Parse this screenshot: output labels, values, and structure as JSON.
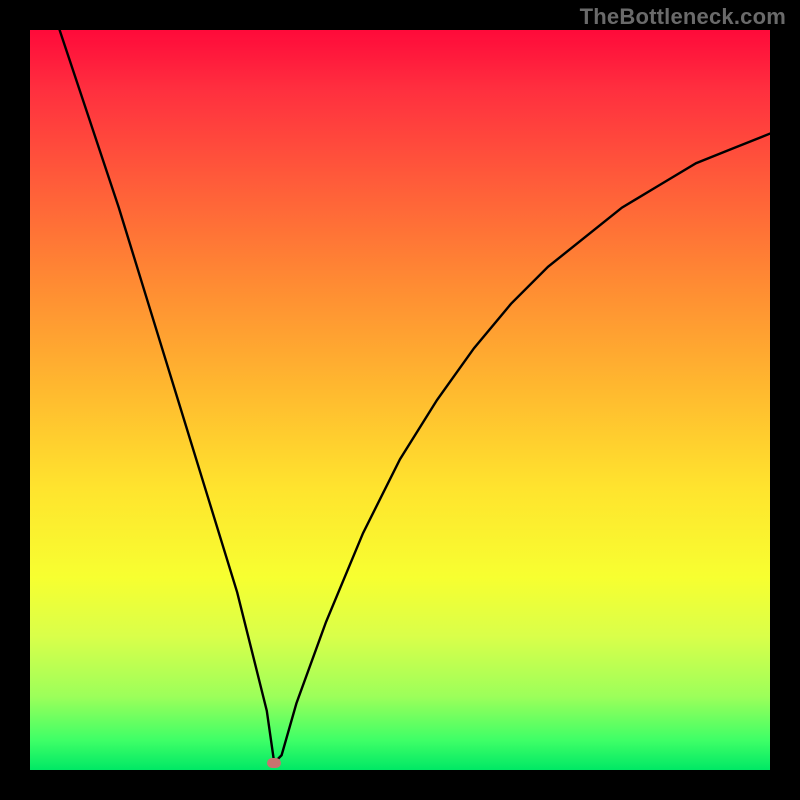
{
  "watermark": "TheBottleneck.com",
  "chart_data": {
    "type": "line",
    "title": "",
    "xlabel": "",
    "ylabel": "",
    "xlim": [
      0,
      100
    ],
    "ylim": [
      0,
      100
    ],
    "grid": false,
    "background_gradient": {
      "top": "#ff0a3a",
      "mid_upper": "#ff8a33",
      "mid_lower": "#ffe42e",
      "bottom": "#00e865"
    },
    "series": [
      {
        "name": "bottleneck-curve",
        "x": [
          4,
          8,
          12,
          16,
          20,
          24,
          28,
          32,
          33,
          34,
          36,
          40,
          45,
          50,
          55,
          60,
          65,
          70,
          75,
          80,
          85,
          90,
          95,
          100
        ],
        "y": [
          100,
          88,
          76,
          63,
          50,
          37,
          24,
          8,
          1,
          2,
          9,
          20,
          32,
          42,
          50,
          57,
          63,
          68,
          72,
          76,
          79,
          82,
          84,
          86
        ]
      }
    ],
    "marker": {
      "x": 33,
      "y": 1,
      "color": "#c7736f"
    }
  }
}
